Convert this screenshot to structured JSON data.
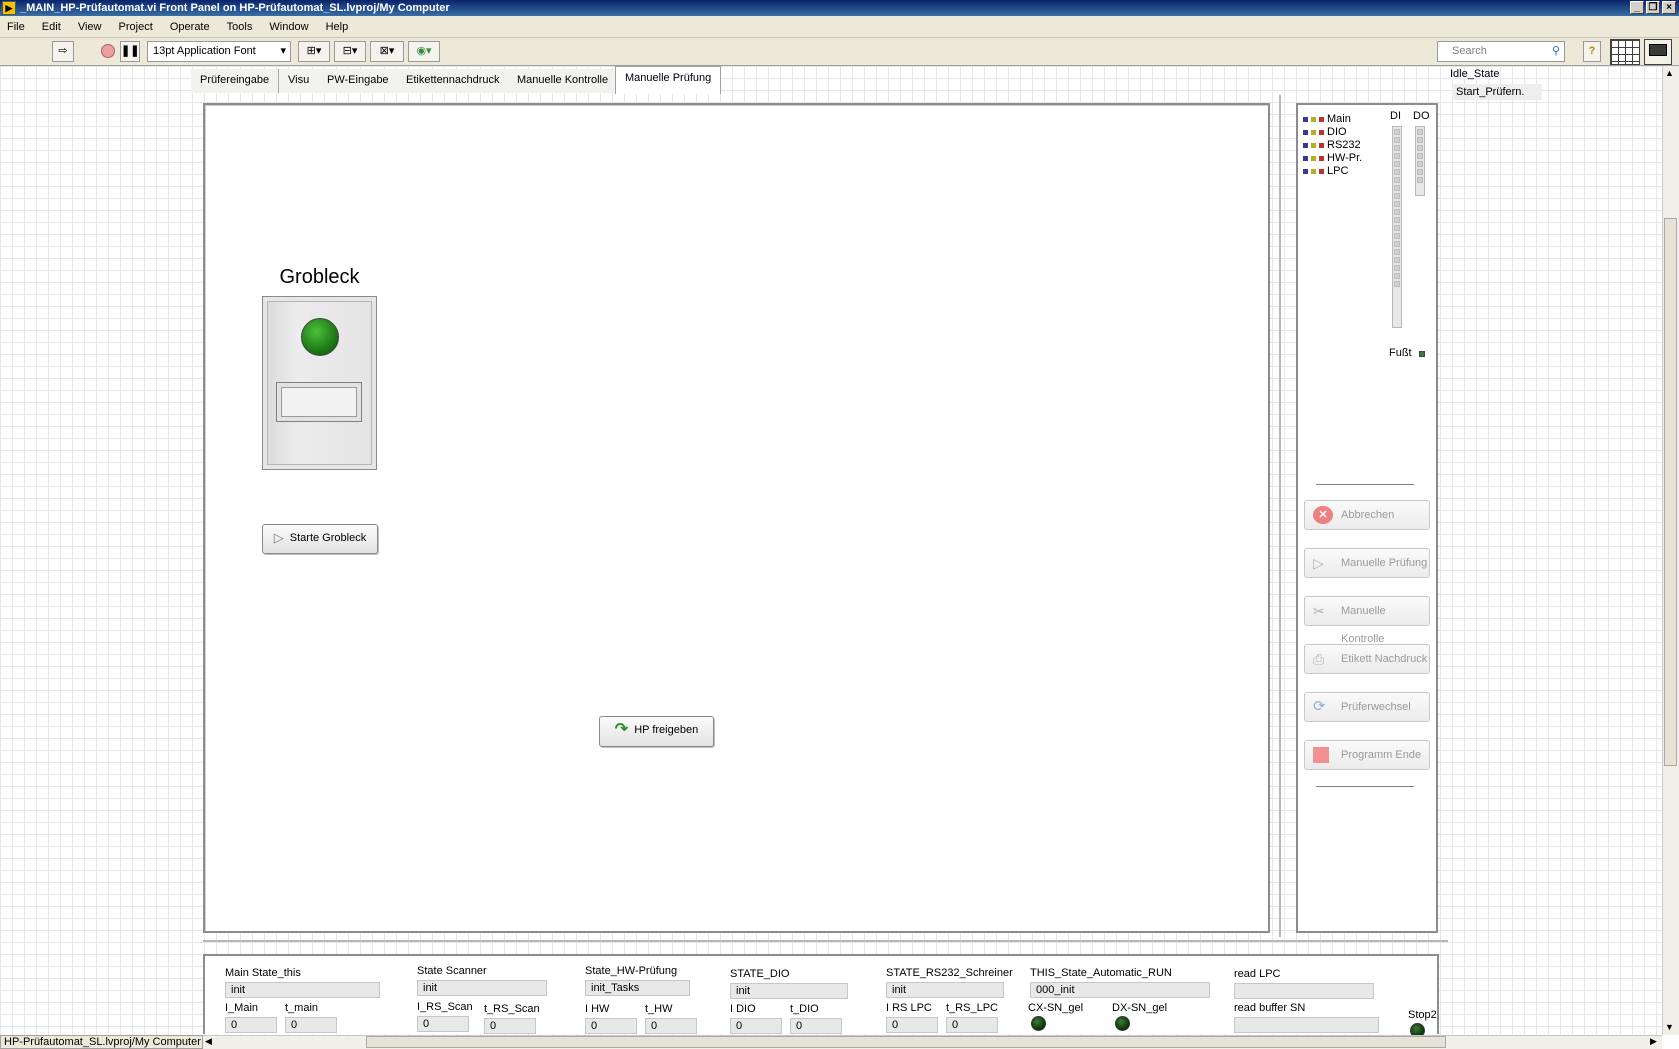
{
  "window": {
    "title": "_MAIN_HP-Prüfautomat.vi Front Panel on HP-Prüfautomat_SL.lvproj/My Computer"
  },
  "menu": [
    "File",
    "Edit",
    "View",
    "Project",
    "Operate",
    "Tools",
    "Window",
    "Help"
  ],
  "toolbar": {
    "font_select": "13pt Application Font",
    "search_placeholder": "Search",
    "help_label": "?"
  },
  "tabs": [
    {
      "label": "Prüfereingabe",
      "active": false
    },
    {
      "label": "Visu",
      "active": false
    },
    {
      "label": "PW-Eingabe",
      "active": false
    },
    {
      "label": "Etikettennachdruck",
      "active": false
    },
    {
      "label": "Manuelle Kontrolle",
      "active": false
    },
    {
      "label": "Manuelle Prüfung",
      "active": true
    }
  ],
  "main": {
    "grobleck_label": "Grobleck",
    "start_button": "Starte Grobleck",
    "release_button": "HP freigeben"
  },
  "side": {
    "legend": [
      "Main",
      "DIO",
      "RS232",
      "HW-Pr.",
      "LPC"
    ],
    "di_label": "DI",
    "do_label": "DO",
    "fusst_label": "Fußt",
    "buttons": [
      {
        "label": "Abbrechen",
        "icon": "cancel-icon"
      },
      {
        "label": "Manuelle Prüfung",
        "icon": "play-icon"
      },
      {
        "label": "Manuelle Kontrolle",
        "icon": "tools-icon"
      },
      {
        "label": "Etikett Nachdruck",
        "icon": "printer-icon"
      },
      {
        "label": "Prüferwechsel",
        "icon": "refresh-icon"
      },
      {
        "label": "Programm Ende",
        "icon": "stop-icon"
      }
    ]
  },
  "state_list": {
    "item1": "Idle_State",
    "item2": "Start_Prüfern."
  },
  "bottom": {
    "groups": [
      {
        "label": "Main State_this",
        "value": "init",
        "i_label": "I_Main",
        "i_value": "0",
        "t_label": "t_main",
        "t_value": "0"
      },
      {
        "label": "State Scanner",
        "value": "init",
        "i_label": "I_RS_Scan",
        "i_value": "0",
        "t_label": "t_RS_Scan",
        "t_value": "0"
      },
      {
        "label": "State_HW-Prüfung",
        "value": "init_Tasks",
        "i_label": "I HW",
        "i_value": "0",
        "t_label": "t_HW",
        "t_value": "0"
      },
      {
        "label": "STATE_DIO",
        "value": "init",
        "i_label": "I DIO",
        "i_value": "0",
        "t_label": "t_DIO",
        "t_value": "0"
      },
      {
        "label": "STATE_RS232_Schreiner",
        "value": "init",
        "i_label": "I RS LPC",
        "i_value": "0",
        "t_label": "t_RS_LPC",
        "t_value": "0"
      }
    ],
    "automatic_label": "THIS_State_Automatic_RUN",
    "automatic_value": "000_init",
    "cx_label": "CX-SN_gel",
    "dx_label": "DX-SN_gel",
    "read_lpc_label": "read LPC",
    "read_buffer_label": "read buffer SN",
    "stop_label": "Stop2"
  },
  "status": {
    "project": "HP-Prüfautomat_SL.lvproj/My Computer"
  }
}
